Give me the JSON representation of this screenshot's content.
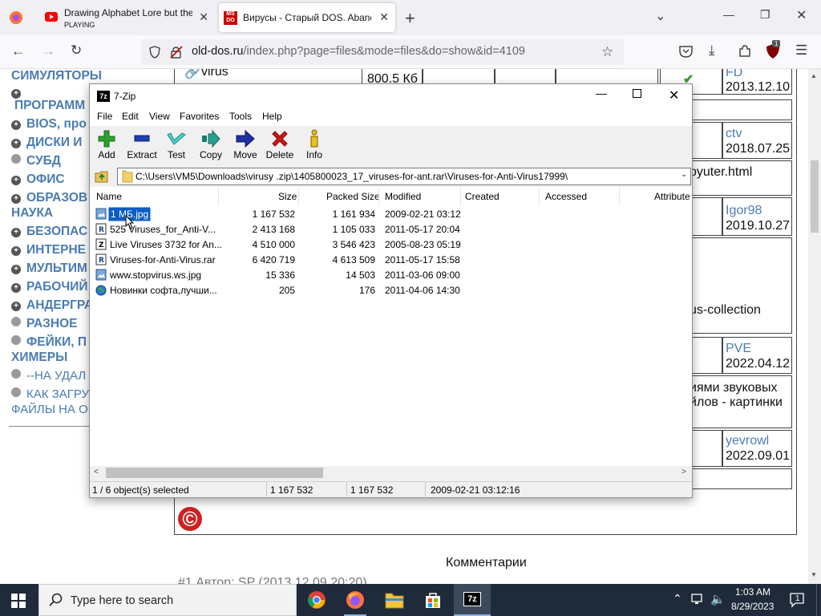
{
  "browser": {
    "tabs": [
      {
        "title": "Drawing Alphabet Lore but the",
        "subtitle": "PLAYING"
      },
      {
        "title": "Вирусы - Старый DOS. Aband"
      }
    ],
    "url_host": "old-dos.ru",
    "url_path": "/index.php?page=files&mode=files&do=show&id=4109",
    "extension_badge": "1"
  },
  "page": {
    "left_menu": [
      "СИМУЛЯТОРЫ",
      "ПРОГРАММ",
      "BIOS, про",
      "ДИСКИ И",
      "СУБД",
      "ОФИС",
      "ОБРАЗОВ",
      "НАУКА",
      "БЕЗОПАС",
      "ИНТЕРНЕ",
      "МУЛЬТИМ",
      "РАБОЧИЙ",
      "АНДЕРГРА",
      "РАЗНОЕ",
      "ФЕЙКИ, П",
      "ХИМЕРЫ",
      "--НА УДАЛ",
      "КАК ЗАГРУ",
      "ФАЙЛЫ НА О"
    ],
    "top_link": "virus",
    "top_size": "800.5 Кб",
    "rows": [
      {
        "user": "FD",
        "date": "2013.12.10"
      },
      {
        "user": "ctv",
        "date": "2018.07.25"
      },
      {
        "user": "",
        "date": "",
        "text": "pyuter.html"
      },
      {
        "user": "Igor98",
        "date": "2019.10.27"
      },
      {
        "user": "",
        "date": "",
        "text": "us-collection"
      },
      {
        "user": "PVE",
        "date": "2022.04.12"
      },
      {
        "user": "",
        "date": "",
        "text": "иями звуковых",
        "text2": "йлов - картинки"
      },
      {
        "user": "yevrowl",
        "date": "2022.09.01"
      }
    ],
    "copyright": "©",
    "comments_heading": "Комментарии",
    "comment_line": "#1 Автор: SP (2013.12.09 20:20)"
  },
  "zip": {
    "title": "7-Zip",
    "menu": [
      "File",
      "Edit",
      "View",
      "Favorites",
      "Tools",
      "Help"
    ],
    "toolbar": [
      {
        "label": "Add",
        "icon": "add-icon"
      },
      {
        "label": "Extract",
        "icon": "extract-icon"
      },
      {
        "label": "Test",
        "icon": "test-icon"
      },
      {
        "label": "Copy",
        "icon": "copy-icon"
      },
      {
        "label": "Move",
        "icon": "move-icon"
      },
      {
        "label": "Delete",
        "icon": "delete-icon"
      },
      {
        "label": "Info",
        "icon": "info-icon"
      }
    ],
    "path": "C:\\Users\\VM5\\Downloads\\virusy .zip\\1405800023_17_viruses-for-ant.rar\\Viruses-for-Anti-Virus17999\\",
    "columns": [
      "Name",
      "Size",
      "Packed Size",
      "Modified",
      "Created",
      "Accessed",
      "Attribute"
    ],
    "files": [
      {
        "name": "1 МБ.jpg",
        "size": "1 167 532",
        "packed": "1 161 934",
        "modified": "2009-02-21 03:12",
        "selected": true,
        "icon": "image-file-icon"
      },
      {
        "name": "525 Viruses_for_Anti-V...",
        "size": "2 413 168",
        "packed": "1 105 033",
        "modified": "2011-05-17 20:04",
        "icon": "rar-file-icon"
      },
      {
        "name": "Live Viruses 3732 for An...",
        "size": "4 510 000",
        "packed": "3 546 423",
        "modified": "2005-08-23 05:19",
        "icon": "zip-file-icon"
      },
      {
        "name": "Viruses-for-Anti-Virus.rar",
        "size": "6 420 719",
        "packed": "4 613 509",
        "modified": "2011-05-17 15:58",
        "icon": "rar-file-icon"
      },
      {
        "name": "www.stopvirus.ws.jpg",
        "size": "15 336",
        "packed": "14 503",
        "modified": "2011-03-06 09:00",
        "icon": "image-file-icon"
      },
      {
        "name": "Новинки софта,лучши...",
        "size": "205",
        "packed": "176",
        "modified": "2011-04-06 14:30",
        "icon": "globe-file-icon"
      }
    ],
    "status": {
      "selected": "1 / 6 object(s) selected",
      "size": "1 167 532",
      "packed": "1 167 532",
      "modified": "2009-02-21 03:12:16"
    }
  },
  "taskbar": {
    "search_placeholder": "Type here to search",
    "time": "1:03 AM",
    "date": "8/29/2023",
    "notification_count": "1"
  }
}
